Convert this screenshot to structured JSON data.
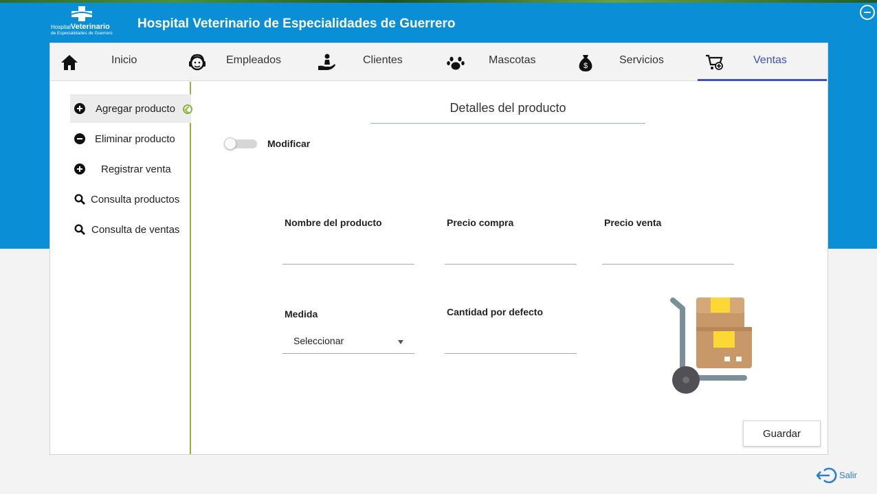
{
  "app": {
    "title": "Hospital Veterinario de Especialidades de Guerrero",
    "logo_line1_small": "Hospital",
    "logo_line1_bold": "Veterinario",
    "logo_line2": "de Especialidades de Guerrero"
  },
  "nav": {
    "items": [
      {
        "label": "Inicio",
        "icon": "home-icon"
      },
      {
        "label": "Empleados",
        "icon": "headset-icon"
      },
      {
        "label": "Clientes",
        "icon": "hand-person-icon"
      },
      {
        "label": "Mascotas",
        "icon": "paw-icon"
      },
      {
        "label": "Servicios",
        "icon": "money-bag-icon"
      },
      {
        "label": "Ventas",
        "icon": "cart-add-icon"
      }
    ],
    "active": "Ventas"
  },
  "sidebar": {
    "items": [
      {
        "label": "Agregar producto",
        "icon": "plus-circle-icon"
      },
      {
        "label": "Eliminar producto",
        "icon": "minus-circle-icon"
      },
      {
        "label": "Registrar venta",
        "icon": "plus-circle-icon"
      },
      {
        "label": "Consulta productos",
        "icon": "search-icon"
      },
      {
        "label": "Consulta de ventas",
        "icon": "search-icon"
      }
    ],
    "active": "Agregar producto"
  },
  "form": {
    "title": "Detalles del producto",
    "toggle_label": "Modificar",
    "toggle_on": false,
    "fields": {
      "nombre": {
        "label": "Nombre del producto",
        "value": ""
      },
      "precio_compra": {
        "label": "Precio compra",
        "value": ""
      },
      "precio_venta": {
        "label": "Precio venta",
        "value": ""
      },
      "medida": {
        "label": "Medida",
        "value": "Seleccionar"
      },
      "cantidad": {
        "label": "Cantidad por defecto",
        "value": ""
      }
    },
    "save_label": "Guardar"
  },
  "footer": {
    "exit_label": "Salir"
  },
  "colors": {
    "banner": "#0a8ed6",
    "nav_active": "#3f51b5",
    "sidebar_accent": "#8fb03d",
    "exit": "#2a7fd0"
  }
}
